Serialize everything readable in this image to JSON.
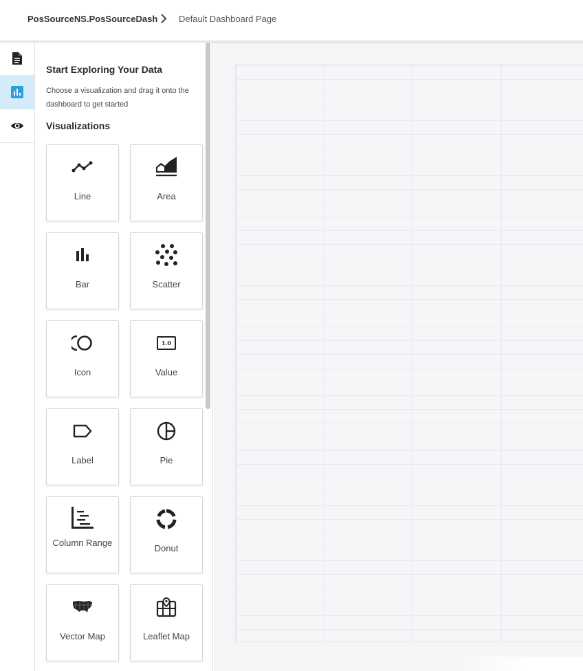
{
  "breadcrumb": {
    "root": "PosSourceNS.PosSourceDash",
    "page": "Default Dashboard Page"
  },
  "rail": [
    {
      "icon": "document-icon",
      "active": false
    },
    {
      "icon": "bar-chart-icon",
      "active": true
    },
    {
      "icon": "eye-icon",
      "active": false
    }
  ],
  "panel": {
    "title": "Start Exploring Your Data",
    "description": "Choose a visualization and drag it onto the dashboard to get started",
    "section": "Visualizations"
  },
  "visualizations": [
    {
      "label": "Line",
      "icon": "line-chart-icon"
    },
    {
      "label": "Area",
      "icon": "area-chart-icon"
    },
    {
      "label": "Bar",
      "icon": "bar-chart-icon"
    },
    {
      "label": "Scatter",
      "icon": "scatter-chart-icon"
    },
    {
      "label": "Icon",
      "icon": "icon-widget-icon"
    },
    {
      "label": "Value",
      "icon": "value-widget-icon",
      "icon_text": "1.0"
    },
    {
      "label": "Label",
      "icon": "label-tag-icon"
    },
    {
      "label": "Pie",
      "icon": "pie-chart-icon"
    },
    {
      "label": "Column Range",
      "icon": "column-range-icon"
    },
    {
      "label": "Donut",
      "icon": "donut-chart-icon"
    },
    {
      "label": "Vector Map",
      "icon": "vector-map-icon"
    },
    {
      "label": "Leaflet Map",
      "icon": "leaflet-map-icon"
    }
  ],
  "colors": {
    "accent": "#2f9fd8",
    "active_bg": "#d4ecf9",
    "canvas_bg": "#f4f5f7"
  }
}
